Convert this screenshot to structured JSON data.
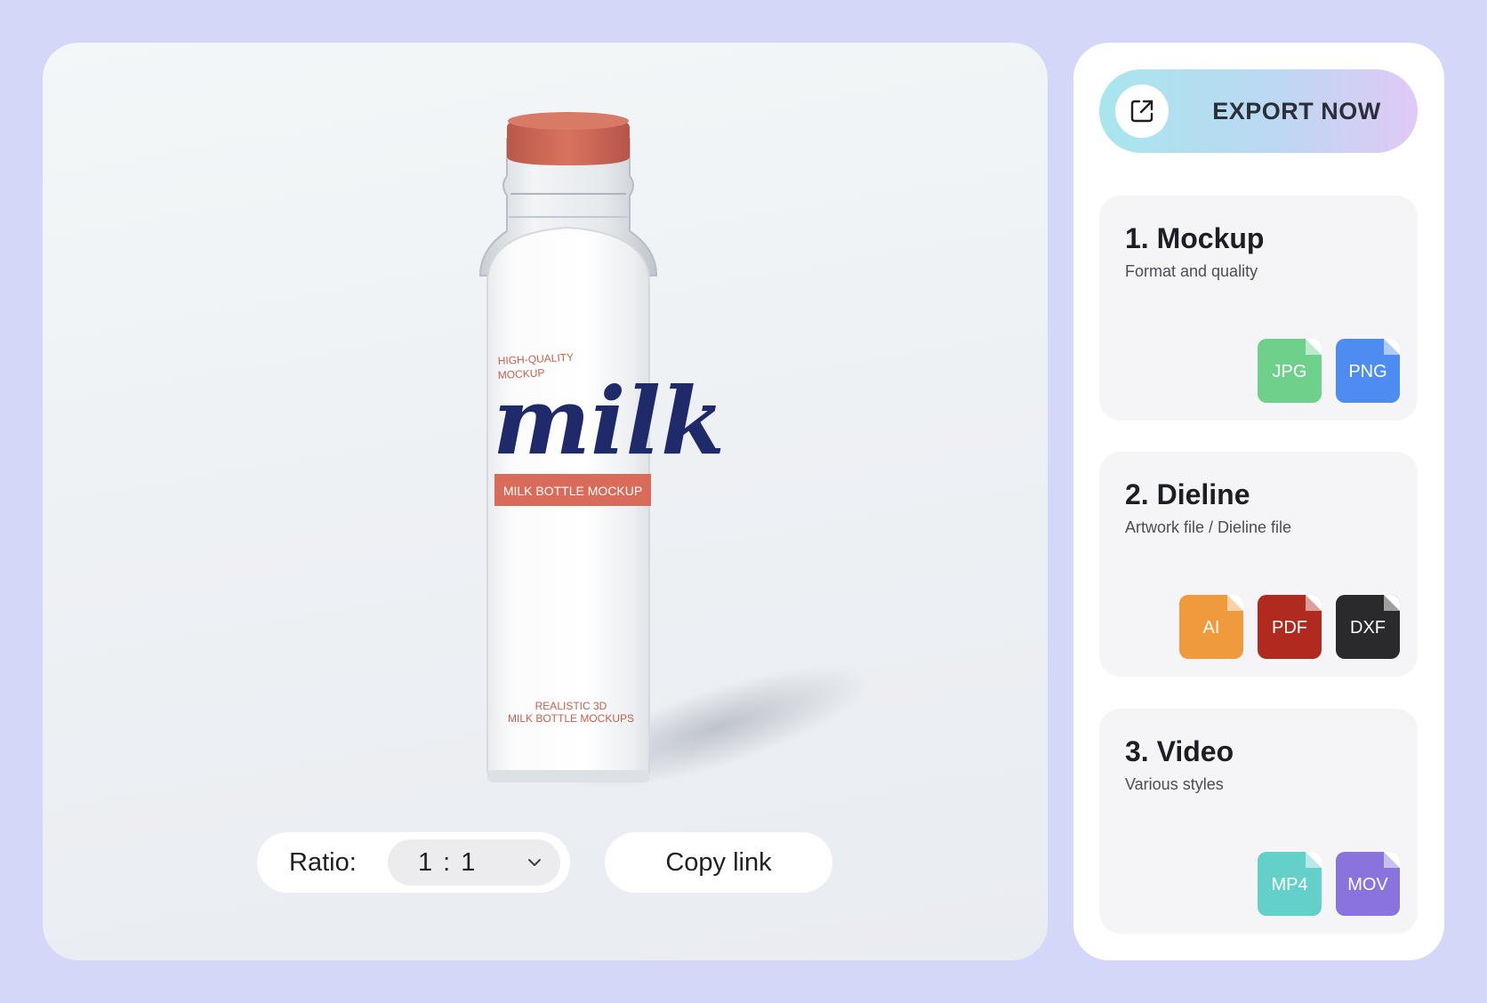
{
  "preview": {
    "product": {
      "top_line_1": "HIGH-QUALITY",
      "top_line_2": "MOCKUP",
      "brand": "milk",
      "banner": "MILK BOTTLE MOCKUP",
      "bottom_line_1": "REALISTIC 3D",
      "bottom_line_2": "MILK BOTTLE MOCKUPS"
    },
    "ratio_label": "Ratio:",
    "ratio_value": "1 : 1",
    "copy_link": "Copy link"
  },
  "panel": {
    "export_label": "EXPORT NOW",
    "sections": [
      {
        "title": "1.  Mockup",
        "subtitle": "Format and quality",
        "formats": [
          {
            "label": "JPG",
            "color": "#6fd08c"
          },
          {
            "label": "PNG",
            "color": "#4e8cf2"
          }
        ]
      },
      {
        "title": "2. Dieline",
        "subtitle": "Artwork file / Dieline file",
        "formats": [
          {
            "label": "AI",
            "color": "#ef9a3c"
          },
          {
            "label": "PDF",
            "color": "#b02a1f"
          },
          {
            "label": "DXF",
            "color": "#2a2a2c"
          }
        ]
      },
      {
        "title": "3. Video",
        "subtitle": "Various styles",
        "formats": [
          {
            "label": "MP4",
            "color": "#63d1c9"
          },
          {
            "label": "MOV",
            "color": "#8a73dd"
          }
        ]
      }
    ]
  },
  "colors": {
    "background": "#d4d7f8",
    "cap": "#cf6a55",
    "brand_text": "#1f2a6b",
    "banner": "#d96b5a"
  },
  "icons": {
    "export": "external-link-icon",
    "ratio_dropdown": "chevron-down-icon"
  }
}
